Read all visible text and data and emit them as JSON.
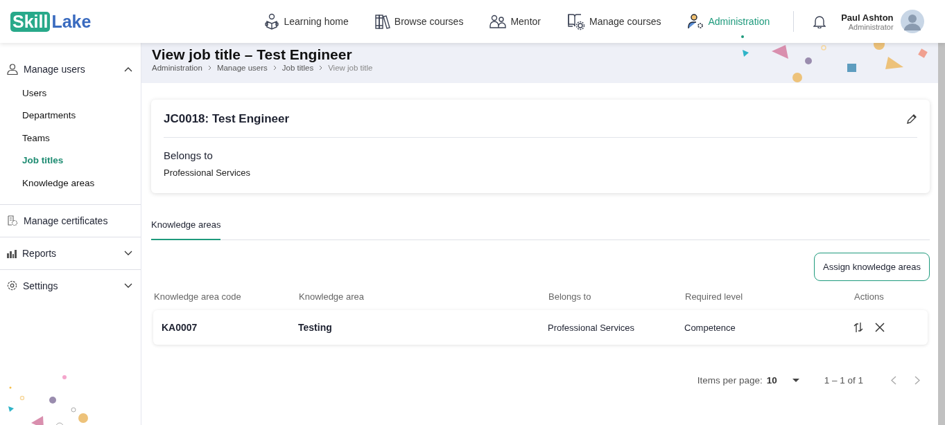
{
  "logo": {
    "part_1": "Skill",
    "part_2": "Lake"
  },
  "nav": [
    {
      "label": "Learning home",
      "selected": false
    },
    {
      "label": "Browse courses",
      "selected": false
    },
    {
      "label": "Mentor",
      "selected": false
    },
    {
      "label": "Manage courses",
      "selected": false
    },
    {
      "label": "Administration",
      "selected": true
    }
  ],
  "user": {
    "name": "Paul Ashton",
    "role": "Administrator"
  },
  "sidebar": {
    "items": [
      {
        "label": "Manage users",
        "expanded": true,
        "children": [
          {
            "label": "Users",
            "selected": false
          },
          {
            "label": "Departments",
            "selected": false
          },
          {
            "label": "Teams",
            "selected": false
          },
          {
            "label": "Job titles",
            "selected": true
          },
          {
            "label": "Knowledge areas",
            "selected": false
          }
        ]
      },
      {
        "label": "Manage certificates"
      },
      {
        "label": "Reports",
        "expanded": false
      },
      {
        "label": "Settings",
        "expanded": false
      }
    ]
  },
  "page": {
    "title": "View job title – Test Engineer",
    "breadcrumb": [
      "Administration",
      "Manage users",
      "Job titles",
      "View job title"
    ]
  },
  "card": {
    "heading": "JC0018: Test Engineer",
    "section_label": "Belongs to",
    "section_value": "Professional Services"
  },
  "tabs": [
    {
      "label": "Knowledge areas",
      "selected": true
    }
  ],
  "assign_button": "Assign knowledge areas",
  "table": {
    "columns": [
      "Knowledge area code",
      "Knowledge area",
      "Belongs to",
      "Required level",
      "Actions"
    ],
    "rows": [
      {
        "cells": [
          "KA0007",
          "Testing",
          "Professional Services",
          "Competence"
        ]
      }
    ]
  },
  "pagination": {
    "label": "Items per page:",
    "page_size": "10",
    "range": "1 – 1 of 1"
  }
}
